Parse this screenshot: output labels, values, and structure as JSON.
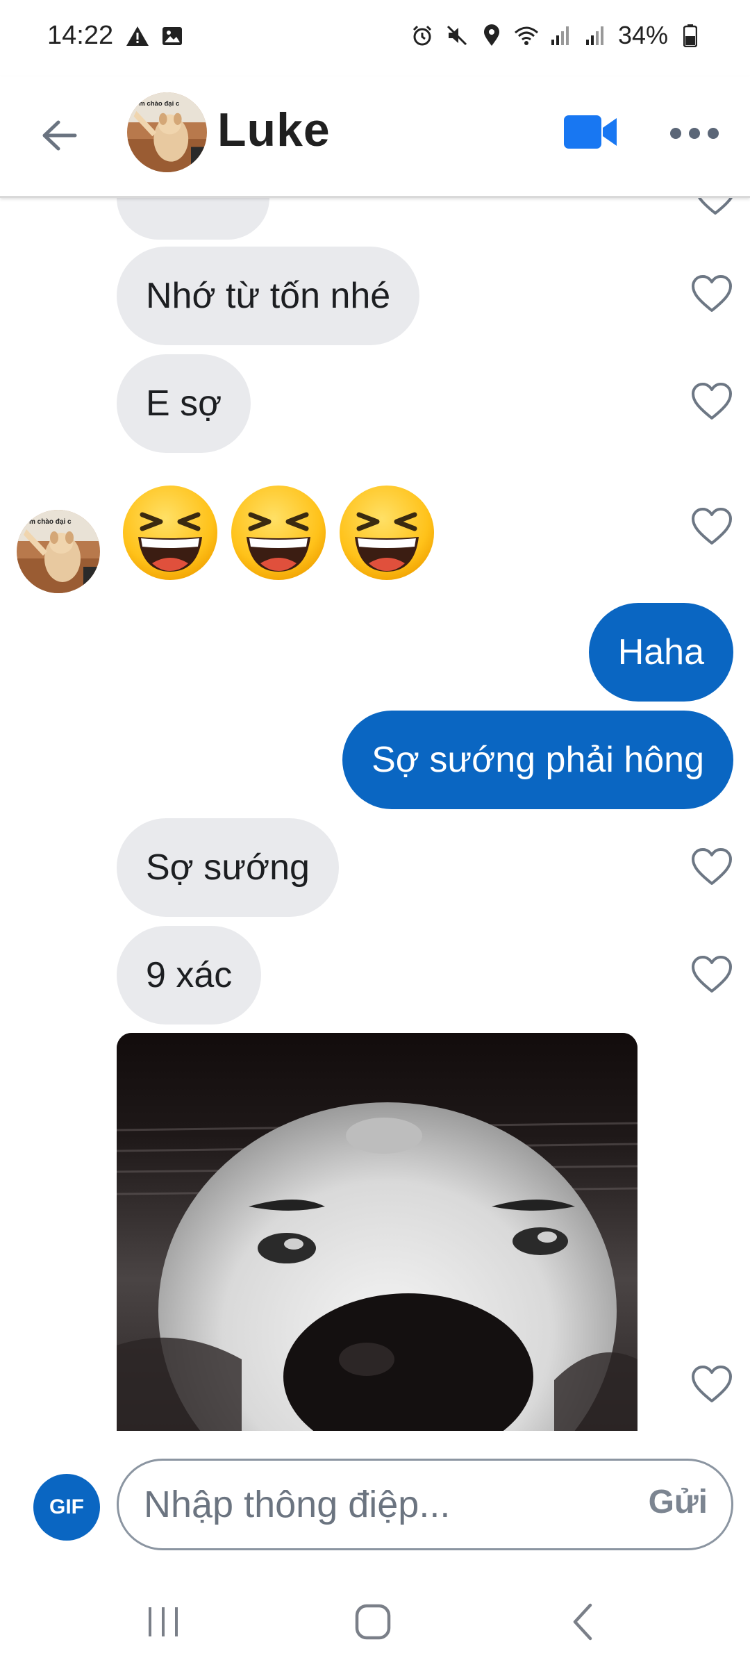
{
  "status_bar": {
    "time": "14:22",
    "battery": "34%"
  },
  "header": {
    "contact_name": "Luke",
    "avatar_caption": "m chào đại c"
  },
  "messages": [
    {
      "direction": "in",
      "text": "Nhớ từ tốn nhé"
    },
    {
      "direction": "in",
      "text": "E sợ"
    },
    {
      "direction": "in",
      "type": "emoji",
      "emoji": [
        "laughing-face",
        "laughing-face",
        "laughing-face"
      ]
    },
    {
      "direction": "out",
      "text": "Haha"
    },
    {
      "direction": "out",
      "text": "Sợ sướng phải hông"
    },
    {
      "direction": "in",
      "text": "Sợ sướng"
    },
    {
      "direction": "in",
      "text": "9 xác"
    },
    {
      "direction": "in",
      "type": "gif",
      "subject": "dog-closeup"
    }
  ],
  "composer": {
    "gif_label": "GIF",
    "placeholder": "Nhập thông điệp...",
    "send_label": "Gửi"
  },
  "colors": {
    "accent": "#0a66c2",
    "incoming_bubble": "#e9eaed"
  }
}
